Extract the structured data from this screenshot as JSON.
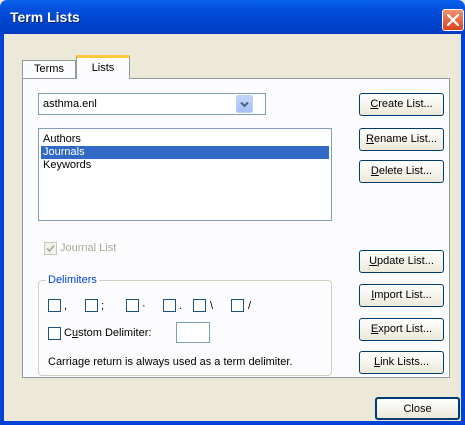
{
  "window": {
    "title": "Term Lists"
  },
  "tabs": [
    {
      "label": "Terms"
    },
    {
      "label": "Lists"
    }
  ],
  "library_select": {
    "value": "asthma.enl"
  },
  "list_items": [
    "Authors",
    "Journals",
    "Keywords"
  ],
  "selected_item": "Journals",
  "buttons": {
    "create_u": "C",
    "create_rest": "reate List...",
    "rename_u": "R",
    "rename_rest": "ename List...",
    "delete_u": "D",
    "delete_rest": "elete List...",
    "update_u": "U",
    "update_rest": "pdate List...",
    "import_u": "I",
    "import_rest": "mport List...",
    "export_u": "E",
    "export_rest": "xport List...",
    "link_u": "L",
    "link_rest": "ink Lists...",
    "close": "Close"
  },
  "journal_list": {
    "label": "Journal List",
    "checked": true,
    "disabled": true
  },
  "delimiters": {
    "label": "Delimiters",
    "chars": [
      ",",
      ";",
      "·",
      ".",
      "\\",
      "/"
    ],
    "custom_label_pre": "C",
    "custom_label_u": "u",
    "custom_label_post": "stom Delimiter:",
    "note": "Carriage return is always used as a term delimiter."
  }
}
